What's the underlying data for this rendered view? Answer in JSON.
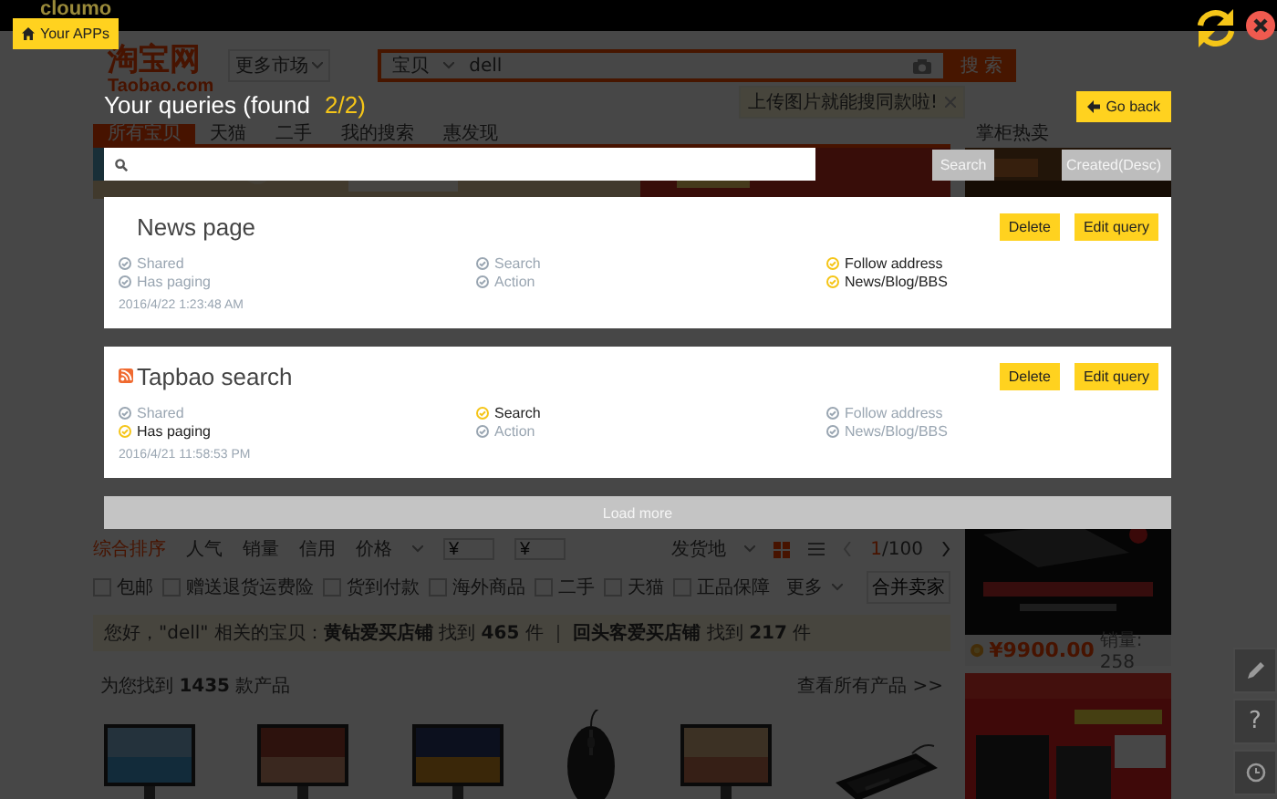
{
  "app_bar": {
    "brand": "cloumo",
    "apps_button": "Your APPs"
  },
  "store_page": {
    "logo": "淘宝网",
    "logo_sub": "Taobao.com",
    "market_select": "更多市场",
    "search_scope": "宝贝",
    "search_value": "dell",
    "search_button": "搜 索",
    "tooltip": "上传图片就能搜同款啦!",
    "tabs": [
      {
        "label": "所有宝贝",
        "selected": true
      },
      {
        "label": "天猫",
        "selected": false
      },
      {
        "label": "二手",
        "selected": false
      },
      {
        "label": "我的搜索",
        "selected": false
      },
      {
        "label": "惠发现",
        "selected": false
      }
    ],
    "side_heading": "掌柜热卖",
    "sort_options": [
      {
        "label": "综合排序",
        "selected": true
      },
      {
        "label": "人气",
        "selected": false
      },
      {
        "label": "销量",
        "selected": false
      },
      {
        "label": "信用",
        "selected": false
      },
      {
        "label": "价格",
        "selected": false
      }
    ],
    "price_from": {
      "placeholder": "¥"
    },
    "price_to": {
      "placeholder": "¥"
    },
    "location": "发货地",
    "page": "1",
    "page_total": "/100",
    "filters": [
      {
        "label": "包邮",
        "checked": false
      },
      {
        "label": "赠送退货运费险",
        "checked": false
      },
      {
        "label": "货到付款",
        "checked": false
      },
      {
        "label": "海外商品",
        "checked": false
      },
      {
        "label": "二手",
        "checked": false
      },
      {
        "label": "天猫",
        "checked": false
      },
      {
        "label": "正品保障",
        "checked": false
      }
    ],
    "more": "更多",
    "merge_sellers": "合并卖家",
    "notice": "您好，\"dell\" 相关的宝贝：**黄钻爱买店铺** 找到 **465** 件 ｜ **回头客爱买店铺** 找到 **217** 件",
    "result_count": "为您找到 **1435** 款产品",
    "view_all": "查看所有产品 >>",
    "ad_price": "¥9900.00",
    "ad_sales": "销量: 258",
    "help_button": "?"
  },
  "queries_panel": {
    "title": "Your queries (found",
    "count": "2/2)",
    "go_back": "Go back",
    "search_button": "Search",
    "sort_button": "Created(Desc)",
    "queries": [
      {
        "name": "News page",
        "badge": false,
        "flags": [
          {
            "label": "Shared",
            "on": false
          },
          {
            "label": "Has paging",
            "on": false
          },
          {
            "label": "Search",
            "on": false
          },
          {
            "label": "Action",
            "on": false
          },
          {
            "label": "Follow address",
            "on": true
          },
          {
            "label": "News/Blog/BBS",
            "on": true
          }
        ],
        "date": "2016/4/22 1:23:48 AM",
        "actions": [
          "Delete",
          "Edit query"
        ]
      },
      {
        "name": "Tapbao search",
        "badge": true,
        "flags": [
          {
            "label": "Shared",
            "on": false
          },
          {
            "label": "Has paging",
            "on": true
          },
          {
            "label": "Search",
            "on": true
          },
          {
            "label": "Action",
            "on": false
          },
          {
            "label": "Follow address",
            "on": false
          },
          {
            "label": "News/Blog/BBS",
            "on": false
          }
        ],
        "date": "2016/4/21 11:58:53 PM",
        "actions": [
          "Delete",
          "Edit query"
        ]
      }
    ],
    "load_more": "Load more"
  }
}
